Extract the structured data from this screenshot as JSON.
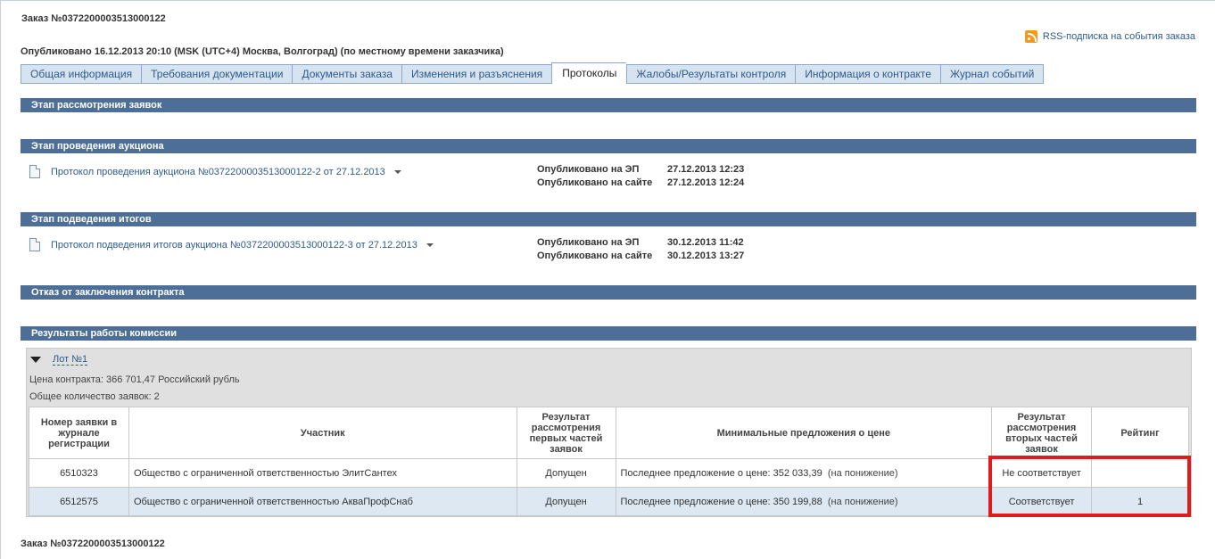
{
  "order": {
    "title": "Заказ №0372200003513000122"
  },
  "published": "Опубликовано 16.12.2013 20:10 (MSK (UTC+4) Москва, Волгоград) (по местному времени заказчика)",
  "rss": {
    "label": "RSS-подписка на события заказа",
    "icon": "rss-icon"
  },
  "tabs": [
    {
      "label": "Общая информация"
    },
    {
      "label": "Требования документации"
    },
    {
      "label": "Документы заказа"
    },
    {
      "label": "Изменения и разъяснения"
    },
    {
      "label": "Протоколы",
      "active": true
    },
    {
      "label": "Жалобы/Результаты контроля"
    },
    {
      "label": "Информация о контракте"
    },
    {
      "label": "Журнал событий"
    }
  ],
  "sections": {
    "review": "Этап рассмотрения заявок",
    "auction": "Этап проведения аукциона",
    "results": "Этап подведения итогов",
    "refusal": "Отказ от заключения контракта",
    "commission": "Результаты работы комиссии"
  },
  "auction_protocol": {
    "link": "Протокол проведения аукциона №0372200003513000122-2 от 27.12.2013",
    "ep_label": "Опубликовано на ЭП",
    "ep_value": "27.12.2013 12:23",
    "site_label": "Опубликовано на сайте",
    "site_value": "27.12.2013 12:24"
  },
  "results_protocol": {
    "link": "Протокол подведения итогов аукциона №0372200003513000122-3 от 27.12.2013",
    "ep_label": "Опубликовано на ЭП",
    "ep_value": "30.12.2013 11:42",
    "site_label": "Опубликовано на сайте",
    "site_value": "30.12.2013 13:27"
  },
  "lot": {
    "title": "Лот №1",
    "price": "Цена контракта: 366 701,47  Российский рубль",
    "count": "Общее количество заявок: 2"
  },
  "table": {
    "headers": {
      "reg_no": "Номер заявки в журнале регистрации",
      "participant": "Участник",
      "first_parts": "Результат рассмотрения первых частей заявок",
      "min_offers": "Минимальные предложения о цене",
      "second_parts": "Результат рассмотрения вторых частей заявок",
      "rating": "Рейтинг"
    },
    "rows": [
      {
        "reg_no": "6510323",
        "participant": "Общество с ограниченной ответственностью ЭлитСантех",
        "first_parts": "Допущен",
        "offer": "Последнее предложение о цене: 352 033,39",
        "direction": "(на понижение)",
        "second_parts": "Не соответствует",
        "rating": ""
      },
      {
        "reg_no": "6512575",
        "participant": "Общество с ограниченной ответственностью АкваПрофСнаб",
        "first_parts": "Допущен",
        "offer": "Последнее предложение о цене: 350 199,88",
        "direction": "(на понижение)",
        "second_parts": "Соответствует",
        "rating": "1"
      }
    ]
  },
  "footer": {
    "order": "Заказ №0372200003513000122"
  },
  "colors": {
    "section_bar": "#4d6e97",
    "link": "#2e5a8c",
    "highlight": "#e11b1b",
    "tab_bg": "#d6e3f1"
  }
}
